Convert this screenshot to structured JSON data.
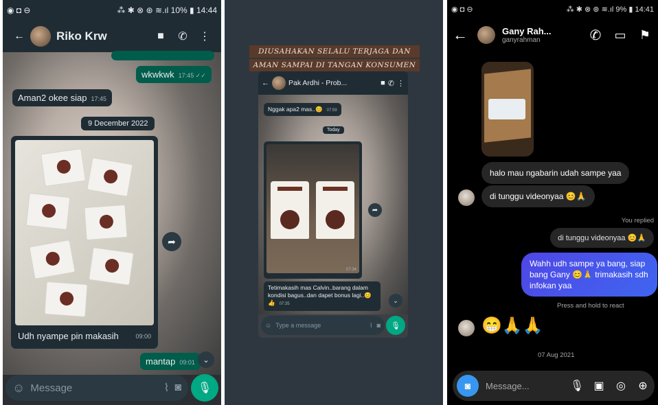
{
  "panel1": {
    "status": {
      "left": "◉ ◘ ⊖",
      "right": "⁂ ✱ ⊗ ⊛ ≋.ıl 10% ▮ 14:44"
    },
    "contact_name": "Riko Krw",
    "messages": {
      "out_wkwkwk": "wkwkwk",
      "out_wkwkwk_time": "17:45 ✓✓",
      "in_aman": "Aman2 okee siap",
      "in_aman_time": "17:45",
      "date_chip": "9 December 2022",
      "photo_caption": "Udh nyampe pin makasih",
      "photo_caption_time": "09:00",
      "out_mantap": "mantap",
      "out_mantap_time": "09:01"
    },
    "input_placeholder": "Message"
  },
  "panel2": {
    "banner_line1": "DIUSAHAKAN SELALU TERJAGA DAN",
    "banner_line2": "AMAN SAMPAI DI TANGAN KONSUMEN",
    "contact_name": "Pak Ardhi - Prob...",
    "messages": {
      "in_nggak": "Nggak apa2 mas..😊",
      "in_nggak_time": "07:59",
      "date_chip": "Today",
      "photo_time": "07:34",
      "in_thanks": "Tetimakasih mas Calvin..barang dalam kondisi bagus..dan dapet bonus lagi..😊👍",
      "in_thanks_time": "07:35"
    },
    "input_placeholder": "Type a message"
  },
  "panel3": {
    "status": {
      "left": "◉ ◘ ⊖",
      "right": "⁂ ✱ ⊗ ⊛ ≋.ıl 9% ▮ 14:41"
    },
    "contact_name": "Gany Rah...",
    "contact_user": "ganyrahman",
    "messages": {
      "in_halo": "halo mau ngabarin udah sampe yaa",
      "in_tunggu": "di tunggu videonyaa 😊🙏",
      "you_replied": "You replied",
      "quoted": "di tunggu videonyaa 😊🙏",
      "out_wahh": "Wahh udh sampe ya bang, siap bang Gany 😊🙏 trimakasih sdh infokan yaa",
      "press_hold": "Press and hold to react",
      "in_emoji": "😁🙏🙏",
      "date": "07 Aug 2021"
    },
    "input_placeholder": "Message..."
  }
}
